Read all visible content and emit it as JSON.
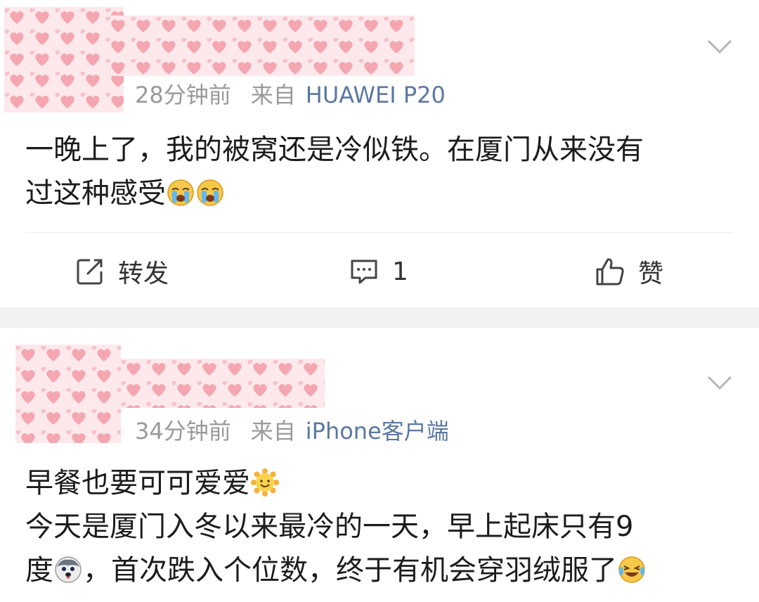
{
  "posts": [
    {
      "time": "28分钟前",
      "source_label": "来自",
      "source_name": "HUAWEI P20",
      "text_lines": [
        "一晚上了，我的被窝还是冷似铁。在厦门从来没有",
        "过这种感受"
      ],
      "line2_emojis": [
        "crying-face-emoji",
        "crying-face-emoji"
      ],
      "actions": {
        "repost_label": "转发",
        "comment_count": "1",
        "like_label": "赞"
      }
    },
    {
      "time": "34分钟前",
      "source_label": "来自",
      "source_name": "iPhone客户端",
      "line1": "早餐也要可可爱爱",
      "line2": "今天是厦门入冬以来最冷的一天，早上起床只有9",
      "line3_prefix": "度",
      "line3_suffix": "，首次跌入个位数，终于有机会穿羽绒服了"
    }
  ],
  "icons": {
    "more": "chevron-down-icon",
    "repost": "repost-icon",
    "comment": "comment-icon",
    "like": "thumbs-up-icon"
  },
  "colors": {
    "meta_gray": "#9a9a9a",
    "source_blue": "#5b78a0",
    "separator": "#f2f2f2",
    "heart_pink": "#f4a7b0"
  }
}
